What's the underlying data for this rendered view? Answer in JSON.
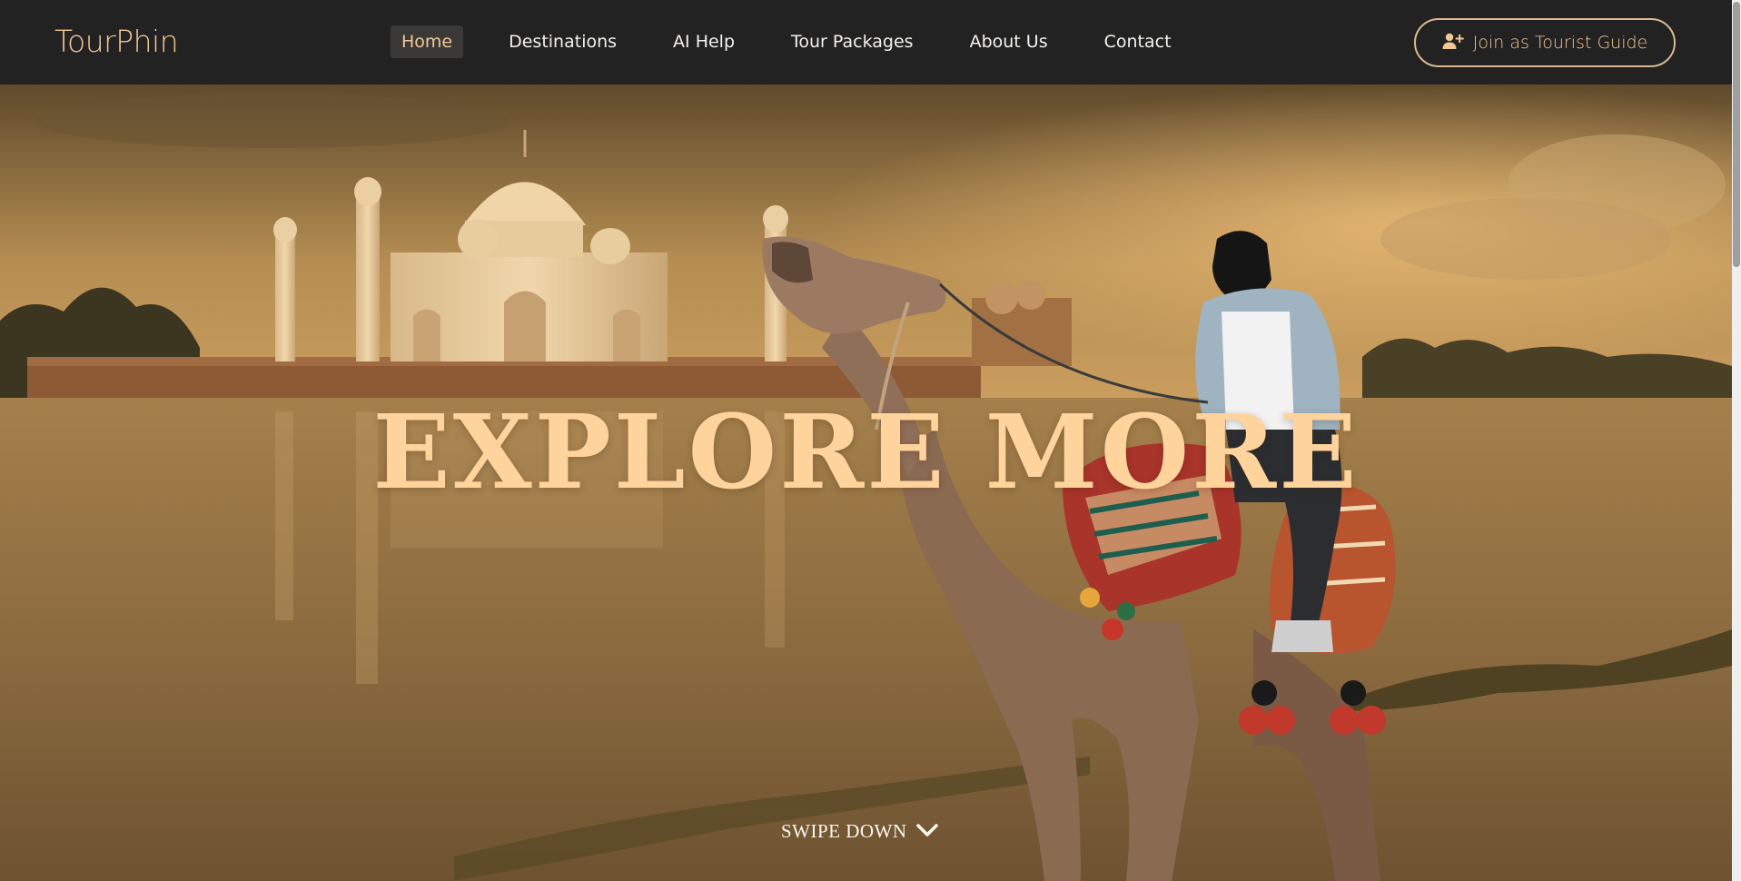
{
  "brand": {
    "name": "TourPhin"
  },
  "nav": {
    "items": [
      {
        "label": "Home",
        "active": true
      },
      {
        "label": "Destinations",
        "active": false
      },
      {
        "label": "AI Help",
        "active": false
      },
      {
        "label": "Tour Packages",
        "active": false
      },
      {
        "label": "About Us",
        "active": false
      },
      {
        "label": "Contact",
        "active": false
      }
    ],
    "join_button": {
      "label": "Join as Tourist Guide",
      "icon": "user-plus-icon"
    }
  },
  "hero": {
    "title": "EXPLORE MORE",
    "swipe_label": "SWIPE DOWN",
    "swipe_icon": "chevron-down-icon"
  },
  "colors": {
    "accent": "#f1c894",
    "navbar_bg": "#232222",
    "hero_title": "#ffd39c"
  }
}
